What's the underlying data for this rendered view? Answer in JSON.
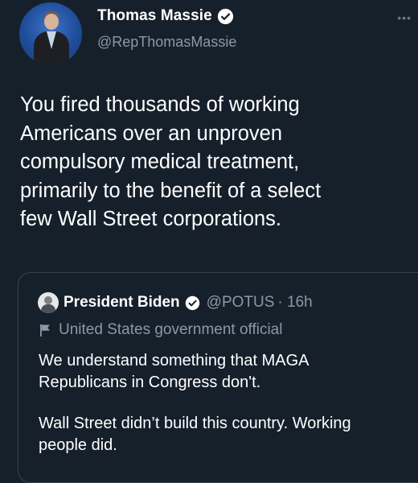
{
  "author": {
    "name": "Thomas Massie",
    "handle": "@RepThomasMassie"
  },
  "tweet": {
    "lines": [
      "You fired thousands of working",
      "Americans over an unproven",
      "compulsory medical treatment,",
      "primarily to the benefit of a select",
      "few Wall Street corporations."
    ]
  },
  "quoted": {
    "name": "President Biden",
    "handle": "@POTUS",
    "time": "· 16h",
    "label": "United States government official",
    "paragraphs": [
      [
        "We understand something that MAGA",
        "Republicans in Congress don't."
      ],
      [
        "Wall Street didn’t build this country. Working",
        "people did."
      ]
    ]
  },
  "icons": {
    "verified": "verified-badge-icon",
    "more": "more-dots-icon",
    "flag": "flag-icon"
  },
  "colors": {
    "background": "#15202b",
    "secondary_text": "#8b98a5",
    "border": "#38444d"
  }
}
